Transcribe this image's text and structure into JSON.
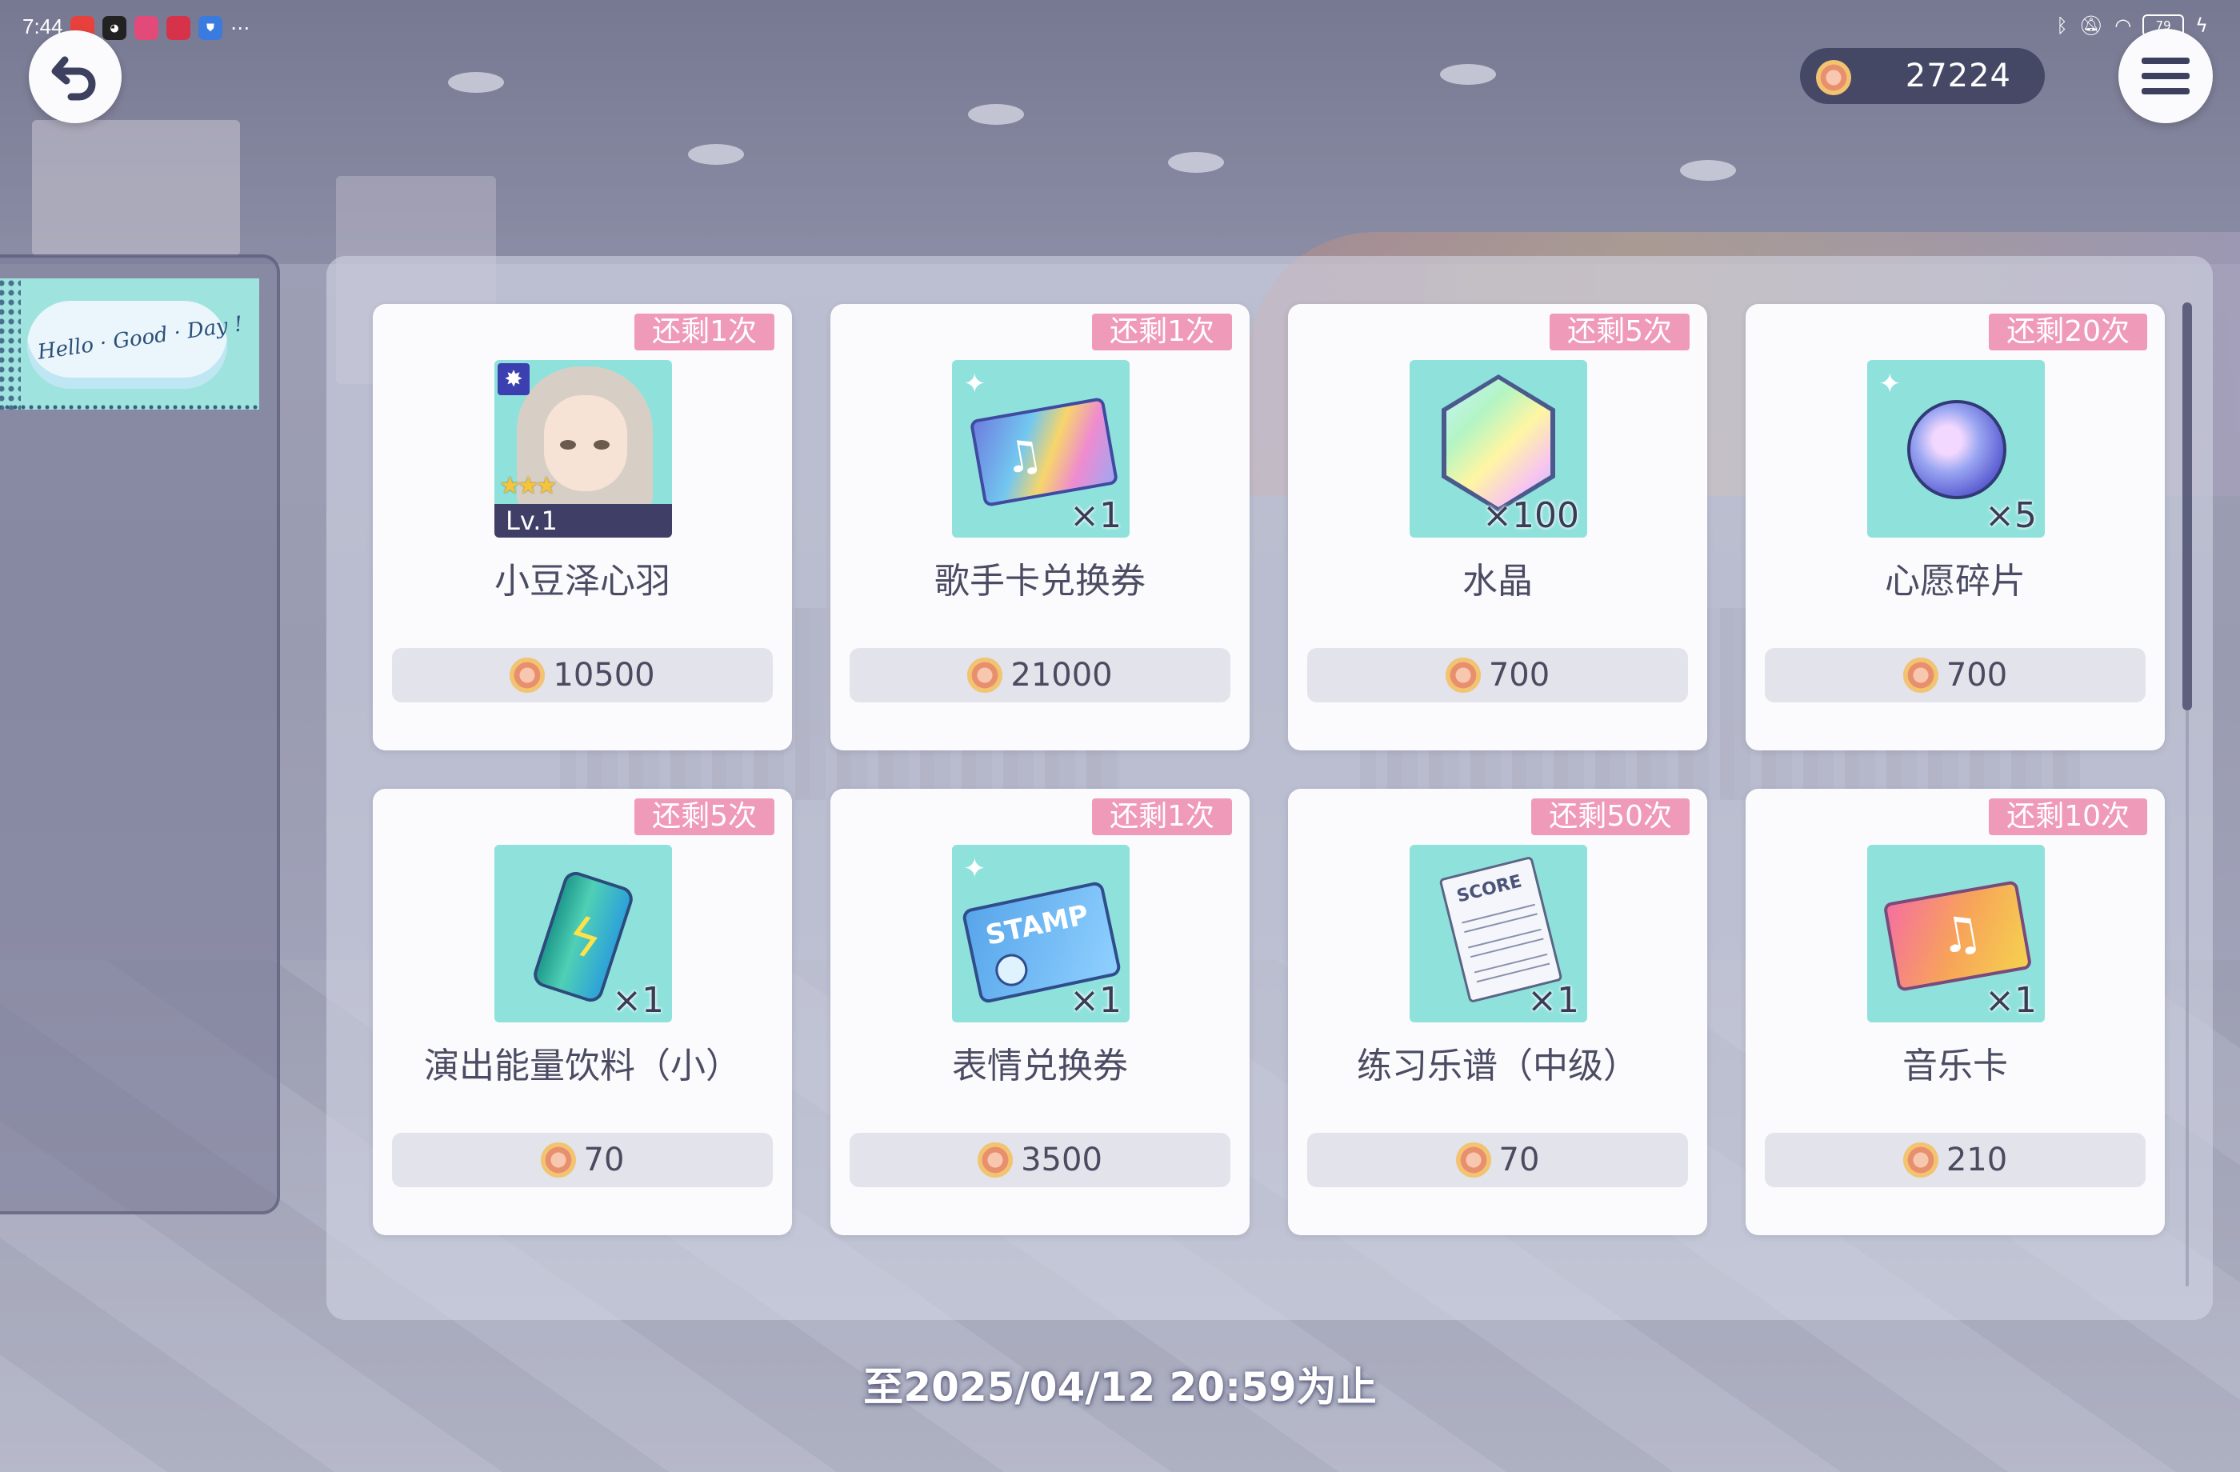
{
  "status_bar": {
    "time": "7:44",
    "battery": "79"
  },
  "currency": {
    "amount": "27224",
    "icon": "coin-icon"
  },
  "sidebar": {
    "banner_text": "Hello · Good · Day !"
  },
  "items": [
    {
      "remaining": "还剩1次",
      "name": "小豆泽心羽",
      "price": "10500",
      "qty": "",
      "level": "Lv.1",
      "icon": "character-card-icon"
    },
    {
      "remaining": "还剩1次",
      "name": "歌手卡兑换券",
      "price": "21000",
      "qty": "×1",
      "icon": "singer-ticket-icon"
    },
    {
      "remaining": "还剩5次",
      "name": "水晶",
      "price": "700",
      "qty": "×100",
      "icon": "crystal-icon"
    },
    {
      "remaining": "还剩20次",
      "name": "心愿碎片",
      "price": "700",
      "qty": "×5",
      "icon": "wish-fragment-icon"
    },
    {
      "remaining": "还剩5次",
      "name": "演出能量饮料（小）",
      "price": "70",
      "qty": "×1",
      "icon": "energy-drink-icon"
    },
    {
      "remaining": "还剩1次",
      "name": "表情兑换券",
      "price": "3500",
      "qty": "×1",
      "stamp_text": "STAMP",
      "icon": "stamp-ticket-icon"
    },
    {
      "remaining": "还剩50次",
      "name": "练习乐谱（中级）",
      "price": "70",
      "qty": "×1",
      "score_text": "SCORE",
      "icon": "practice-score-icon"
    },
    {
      "remaining": "还剩10次",
      "name": "音乐卡",
      "price": "210",
      "qty": "×1",
      "icon": "music-card-icon"
    }
  ],
  "deadline": "至2025/04/12 20:59为止",
  "colors": {
    "tag_pink": "#ef9ab8",
    "thumb_teal": "#8fe1dc",
    "panel": "#d6d8e8"
  }
}
